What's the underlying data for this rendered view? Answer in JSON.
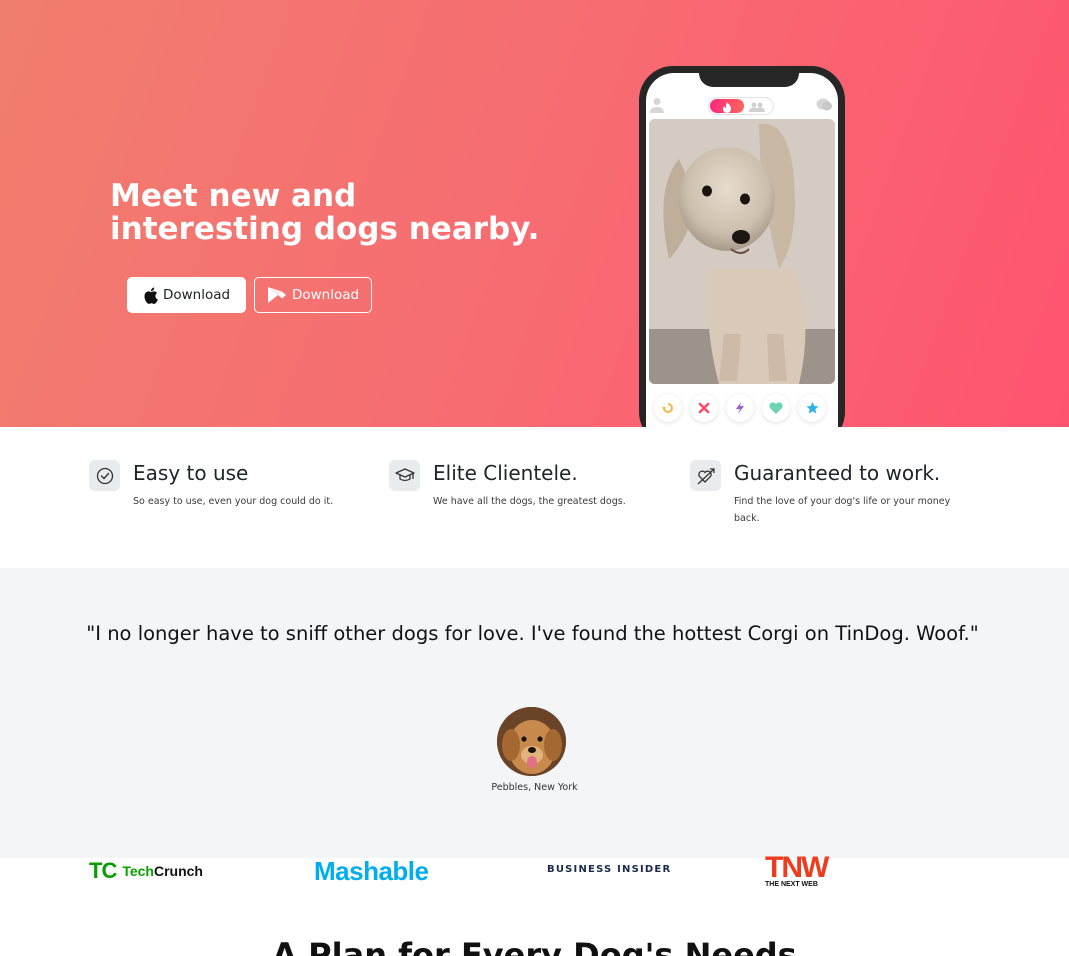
{
  "hero": {
    "title": "Meet new and interesting dogs nearby.",
    "apple_button": {
      "label": "Download",
      "icon": "apple-icon"
    },
    "google_button": {
      "label": "Download",
      "icon": "google-play-icon"
    },
    "gradient": [
      "#f07e6e",
      "#ff5470"
    ]
  },
  "phone": {
    "actions": [
      "rewind-icon",
      "nope-icon",
      "boost-icon",
      "like-icon",
      "superlike-icon"
    ]
  },
  "features": [
    {
      "icon": "check-circle-icon",
      "title": "Easy to use",
      "text": "So easy to use, even your dog could do it."
    },
    {
      "icon": "graduation-cap-icon",
      "title": "Elite Clientele.",
      "text": "We have all the dogs, the greatest dogs."
    },
    {
      "icon": "heart-arrow-icon",
      "title": "Guaranteed to work.",
      "text": "Find the love of your dog's life or your money back."
    }
  ],
  "testimonial": {
    "quote": "\"I no longer have to sniff other dogs for love. I've found the hottest Corgi on TinDog. Woof.\"",
    "author": "Pebbles, New York"
  },
  "press": {
    "techcrunch": {
      "mark": "TC",
      "name_a": "Tech",
      "name_b": "Crunch"
    },
    "mashable": "Mashable",
    "business_insider": "BUSINESS INSIDER",
    "tnw": {
      "mark": "TNW",
      "sub": "THE NEXT WEB"
    }
  },
  "pricing": {
    "title": "A Plan for Every Dog's Needs"
  }
}
